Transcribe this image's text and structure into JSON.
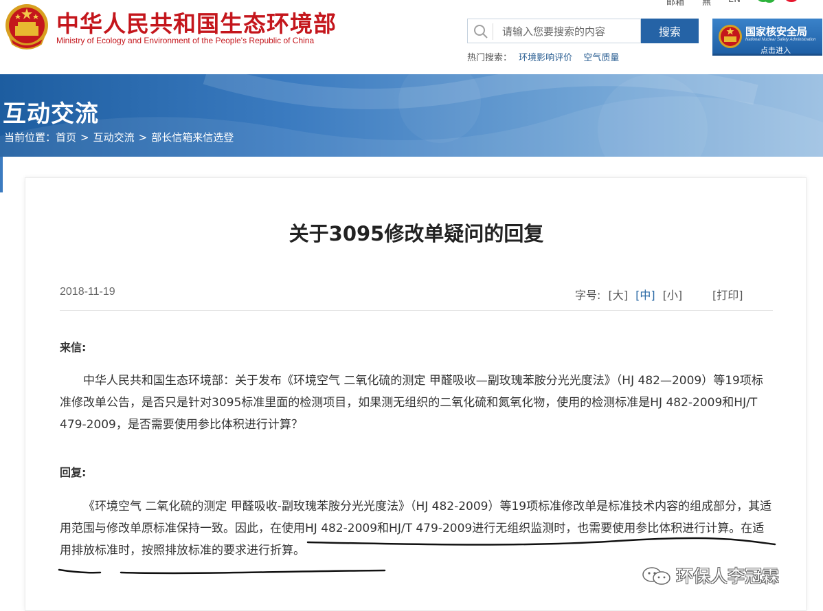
{
  "header": {
    "site_title": "中华人民共和国生态环境部",
    "site_subtitle": "Ministry of Ecology and Environment of the People's Republic of China",
    "top_links": {
      "mail": "邮箱",
      "barrier_free": "無",
      "en": "EN"
    },
    "search": {
      "placeholder": "请输入您要搜索的内容",
      "button": "搜索"
    },
    "hot_search": {
      "label": "热门搜索：",
      "items": [
        "环境影响评价",
        "空气质量"
      ]
    },
    "nnsa": {
      "title": "国家核安全局",
      "subtitle": "National Nuclear Safety Administration",
      "enter": "点击进入"
    }
  },
  "banner": {
    "title": "互动交流",
    "breadcrumb": {
      "prefix": "当前位置：",
      "items": [
        "首页",
        "互动交流",
        "部长信箱来信选登"
      ],
      "separator": ">"
    }
  },
  "article": {
    "title": "关于3095修改单疑问的回复",
    "date": "2018-11-19",
    "font_size": {
      "label": "字号:",
      "large": "[大]",
      "medium": "[中]",
      "small": "[小]"
    },
    "print": "[打印]",
    "letter_label": "来信:",
    "letter_text": "中华人民共和国生态环境部：关于发布《环境空气 二氧化硫的测定 甲醛吸收—副玫瑰苯胺分光光度法》（HJ 482—2009）等19项标准修改单公告，是否只是针对3095标准里面的检测项目，如果测无组织的二氧化硫和氮氧化物，使用的检测标准是HJ 482-2009和HJ/T 479-2009，是否需要使用参比体积进行计算？",
    "reply_label": "回复:",
    "reply_text": "《环境空气 二氧化硫的测定 甲醛吸收-副玫瑰苯胺分光光度法》（HJ 482-2009）等19项标准修改单是标准技术内容的组成部分，其适用范围与修改单原标准保持一致。因此，在使用HJ 482-2009和HJ/T 479-2009进行无组织监测时，也需要使用参比体积进行计算。在适用排放标准时，按照排放标准的要求进行折算。"
  },
  "watermark": {
    "text": "环保人李冠霖",
    "icon": "wechat-icon"
  },
  "colors": {
    "brand_red": "#c4161c",
    "accent_blue": "#2563a6",
    "active_blue": "#2b6aa5"
  }
}
